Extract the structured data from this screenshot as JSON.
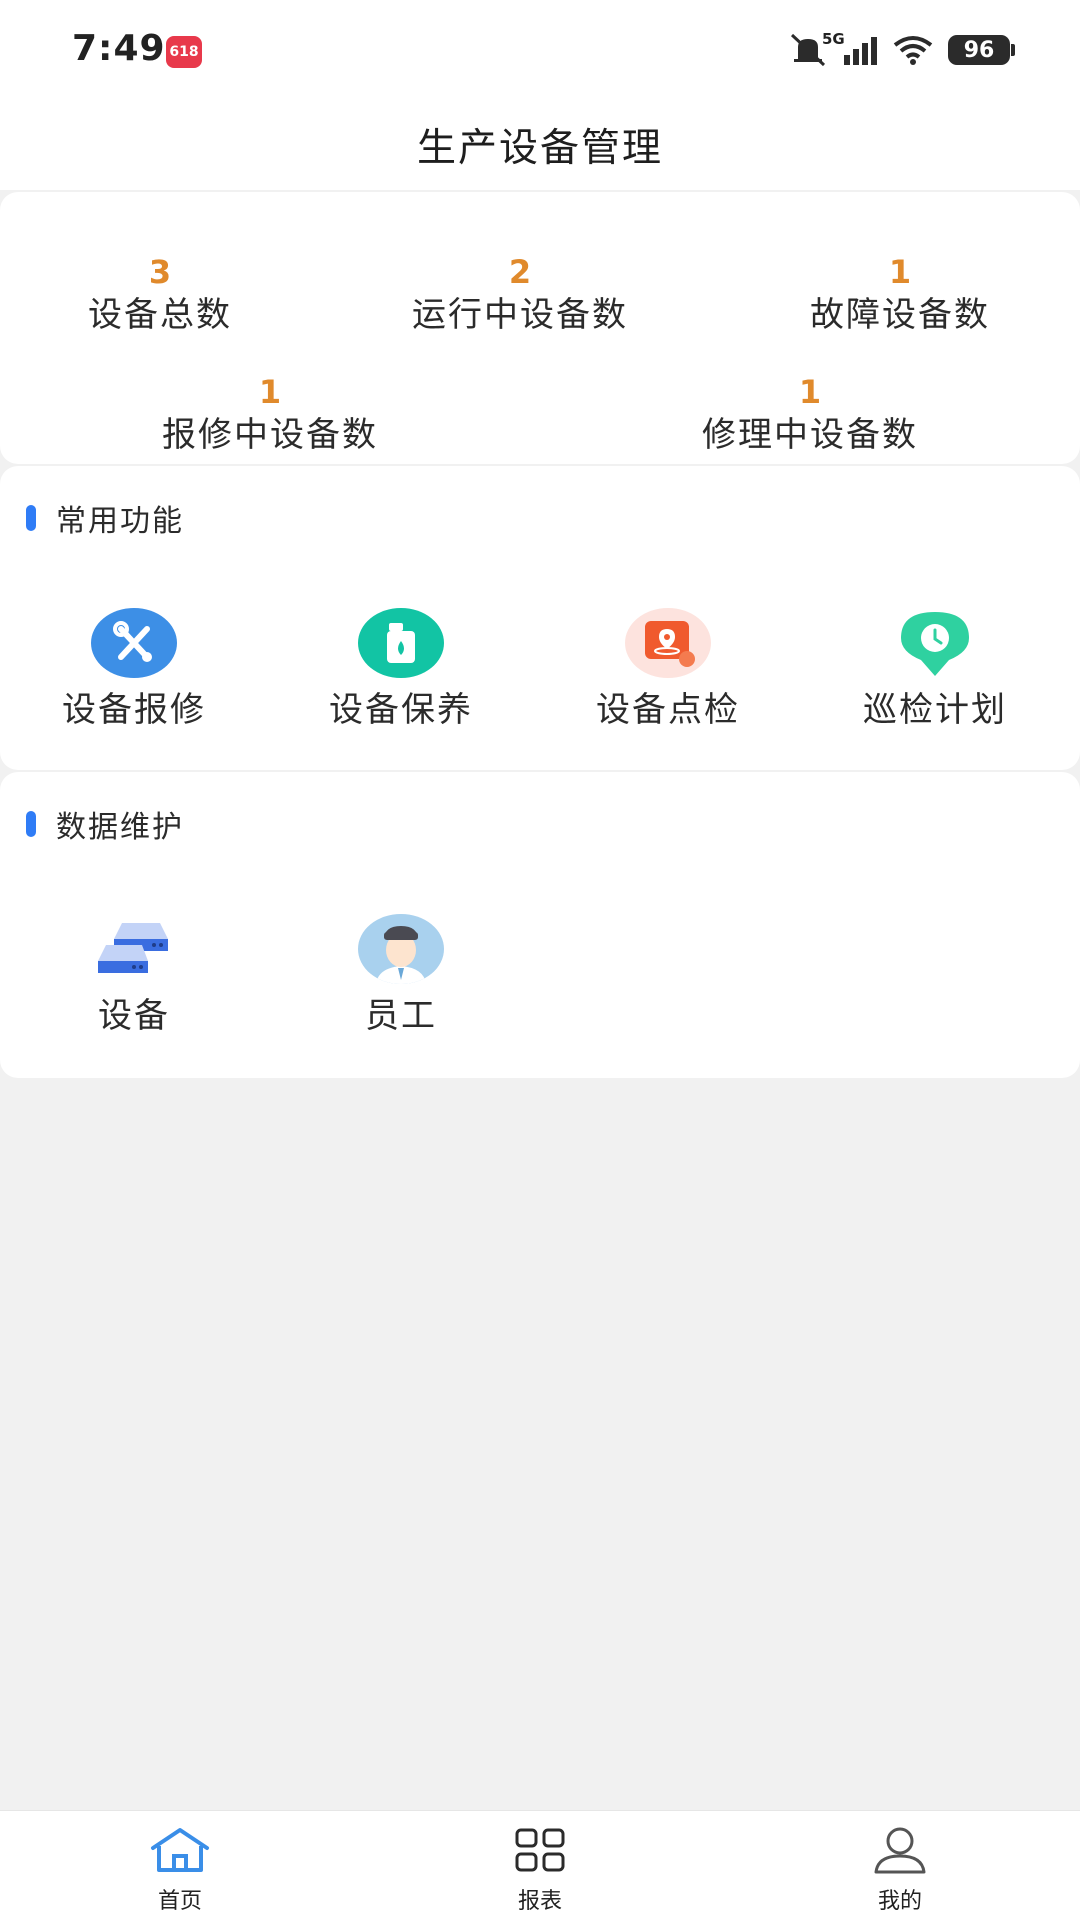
{
  "status_bar": {
    "time": "7:49",
    "app_badge": "618",
    "network": "5G",
    "battery": "96"
  },
  "header": {
    "title": "生产设备管理"
  },
  "stats": [
    {
      "value": "3",
      "label": "设备总数"
    },
    {
      "value": "2",
      "label": "运行中设备数"
    },
    {
      "value": "1",
      "label": "故障设备数"
    },
    {
      "value": "1",
      "label": "报修中设备数"
    },
    {
      "value": "1",
      "label": "修理中设备数"
    }
  ],
  "common_functions": {
    "title": "常用功能",
    "items": [
      {
        "label": "设备报修",
        "icon": "wrench-icon",
        "color": "#3d8fe6"
      },
      {
        "label": "设备保养",
        "icon": "oil-can-icon",
        "color": "#12c4a4"
      },
      {
        "label": "设备点检",
        "icon": "location-card-icon",
        "color": "#f05a2e"
      },
      {
        "label": "巡检计划",
        "icon": "clock-pin-icon",
        "color": "#2fd1a0"
      }
    ]
  },
  "data_maintenance": {
    "title": "数据维护",
    "items": [
      {
        "label": "设备",
        "icon": "server-icon"
      },
      {
        "label": "员工",
        "icon": "employee-avatar-icon"
      }
    ]
  },
  "bottom_nav": {
    "items": [
      {
        "label": "首页",
        "icon": "home-icon",
        "active": true
      },
      {
        "label": "报表",
        "icon": "grid-icon",
        "active": false
      },
      {
        "label": "我的",
        "icon": "user-icon",
        "active": false
      }
    ]
  },
  "colors": {
    "accent": "#2f7cf6",
    "stat_value": "#e08a2c",
    "background": "#f1f1f1"
  }
}
